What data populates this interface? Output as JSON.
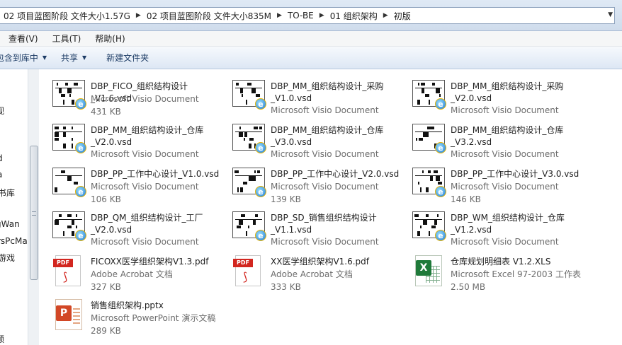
{
  "breadcrumb": [
    "02 项目蓝图阶段 文件大小1.57G",
    "02 项目蓝图阶段 文件大小835M",
    "TO-BE",
    "01 组织架构",
    "初版"
  ],
  "menu": [
    "查看(V)",
    "工具(T)",
    "帮助(H)"
  ],
  "toolbar": {
    "library_label": "包含到库中",
    "share_label": "共享",
    "new_folder_label": "新建文件夹"
  },
  "nav": [
    "视",
    "d",
    "a",
    "书库",
    "gWan",
    "rsPcMa",
    "游戏",
    "频"
  ],
  "files": [
    {
      "name": "DBP_FICO_组织结构设计_V1.6.vsd",
      "type": "Microsoft Visio Document",
      "size": "431 KB",
      "icon": "visio-icon"
    },
    {
      "name": "DBP_MM_组织结构设计_采购_V1.0.vsd",
      "type": "Microsoft Visio Document",
      "size": "",
      "icon": "visio-icon"
    },
    {
      "name": "DBP_MM_组织结构设计_采购_V2.0.vsd",
      "type": "Microsoft Visio Document",
      "size": "",
      "icon": "visio-icon"
    },
    {
      "name": "DBP_MM_组织结构设计_仓库_V2.0.vsd",
      "type": "Microsoft Visio Document",
      "size": "",
      "icon": "visio-icon"
    },
    {
      "name": "DBP_MM_组织结构设计_仓库_V3.0.vsd",
      "type": "Microsoft Visio Document",
      "size": "",
      "icon": "visio-icon"
    },
    {
      "name": "DBP_MM_组织结构设计_仓库_V3.2.vsd",
      "type": "Microsoft Visio Document",
      "size": "",
      "icon": "visio-icon"
    },
    {
      "name": "DBP_PP_工作中心设计_V1.0.vsd",
      "type": "Microsoft Visio Document",
      "size": "106 KB",
      "icon": "visio-icon"
    },
    {
      "name": "DBP_PP_工作中心设计_V2.0.vsd",
      "type": "Microsoft Visio Document",
      "size": "139 KB",
      "icon": "visio-icon"
    },
    {
      "name": "DBP_PP_工作中心设计_V3.0.vsd",
      "type": "Microsoft Visio Document",
      "size": "146 KB",
      "icon": "visio-icon"
    },
    {
      "name": "DBP_QM_组织结构设计_工厂_V2.0.vsd",
      "type": "Microsoft Visio Document",
      "size": "",
      "icon": "visio-icon"
    },
    {
      "name": "DBP_SD_销售组织结构设计_V1.1.vsd",
      "type": "Microsoft Visio Document",
      "size": "",
      "icon": "visio-icon"
    },
    {
      "name": "DBP_WM_组织结构设计_仓库_V1.2.vsd",
      "type": "Microsoft Visio Document",
      "size": "",
      "icon": "visio-icon"
    },
    {
      "name": "FICOXX医学组织架构V1.3.pdf",
      "type": "Adobe Acrobat 文档",
      "size": "327 KB",
      "icon": "pdf-icon"
    },
    {
      "name": "XX医学组织架构V1.6.pdf",
      "type": "Adobe Acrobat 文档",
      "size": "333 KB",
      "icon": "pdf-icon"
    },
    {
      "name": "仓库规划明细表 V1.2.XLS",
      "type": "Microsoft Excel 97-2003 工作表",
      "size": "2.50 MB",
      "icon": "excel-icon"
    },
    {
      "name": "销售组织架构.pptx",
      "type": "Microsoft PowerPoint 演示文稿",
      "size": "289 KB",
      "icon": "powerpoint-icon"
    }
  ],
  "pdf_badge": "PDF"
}
